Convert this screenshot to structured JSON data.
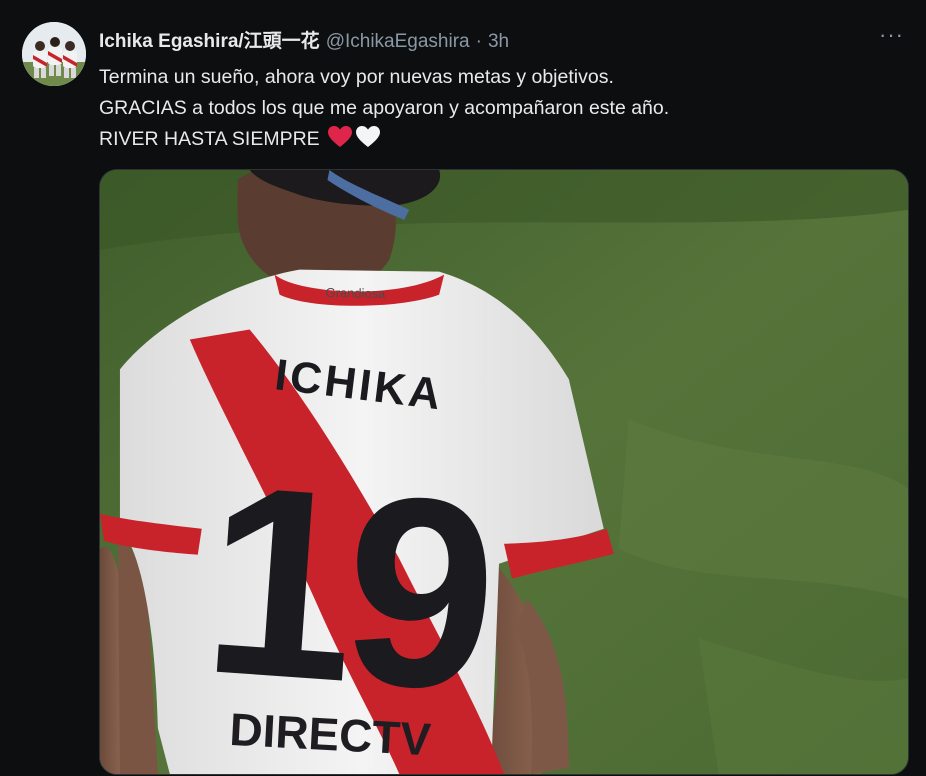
{
  "tweet": {
    "display_name": "Ichika Egashira/江頭一花",
    "handle": "@IchikaEgashira",
    "separator": "·",
    "time": "3h",
    "more_label": "···",
    "text_lines": [
      "Termina un sueño, ahora voy por nuevas metas y objetivos.",
      "GRACIAS a todos los que me apoyaron y acompañaron este año.",
      "RIVER HASTA SIEMPRE"
    ],
    "emojis": [
      "red-heart-icon",
      "white-heart-icon"
    ]
  },
  "photo": {
    "jersey_name": "ICHIKA",
    "jersey_number": "19",
    "collar_text": "Grandiosa",
    "sponsor": "DIRECTV"
  },
  "colors": {
    "background": "#0d0e10",
    "text": "#e7e9ea",
    "secondary_text": "#8b98a5",
    "jersey_red": "#d4232b",
    "grass": "#4f6d35"
  }
}
